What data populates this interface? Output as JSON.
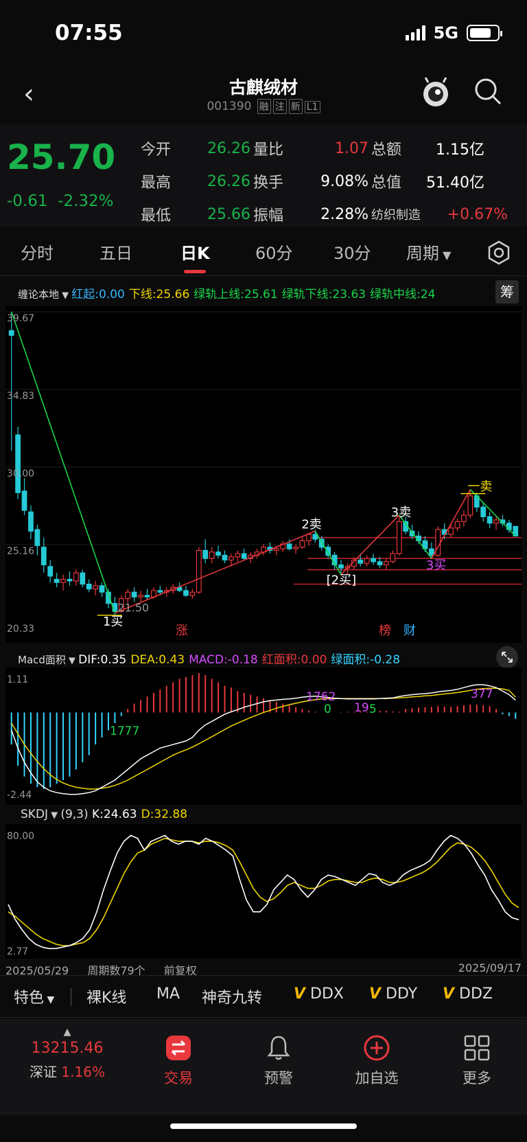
{
  "status": {
    "time": "07:55",
    "network": "5G"
  },
  "header": {
    "title": "古麒绒材",
    "code": "001390",
    "tags": [
      "融",
      "注",
      "新",
      "L1"
    ]
  },
  "quote": {
    "price": "25.70",
    "change": "-0.61",
    "change_pct": "-2.32%",
    "rows": [
      [
        {
          "k": "今开",
          "v": "26.26",
          "c": "green"
        },
        {
          "k": "量比",
          "v": "1.07",
          "c": "red"
        },
        {
          "k": "总额",
          "v": "1.15亿",
          "c": "white"
        }
      ],
      [
        {
          "k": "最高",
          "v": "26.26",
          "c": "green"
        },
        {
          "k": "换手",
          "v": "9.08%",
          "c": "white"
        },
        {
          "k": "总值",
          "v": "51.40亿",
          "c": "white"
        }
      ],
      [
        {
          "k": "最低",
          "v": "25.66",
          "c": "green"
        },
        {
          "k": "振幅",
          "v": "2.28%",
          "c": "white"
        },
        {
          "k": "纺织制造",
          "v": "+0.67%",
          "c": "red"
        }
      ]
    ]
  },
  "tabs": [
    "分时",
    "五日",
    "日K",
    "60分",
    "30分",
    "周期"
  ],
  "main_indicator": {
    "name": "缠论本地",
    "items": [
      {
        "t": "红起:0.00",
        "c": "#35b5ff"
      },
      {
        "t": "下线:25.66",
        "c": "#f2d600"
      },
      {
        "t": "绿轨上线:25.61",
        "c": "#19d64b"
      },
      {
        "t": "绿轨下线:23.63",
        "c": "#19d64b"
      },
      {
        "t": "绿轨中线:24",
        "c": "#19d64b"
      }
    ],
    "side_button": "筹"
  },
  "chart_data": [
    {
      "type": "candlestick",
      "y_ticks": [
        "39.67",
        "34.83",
        "30.00",
        "25.16",
        "20.33"
      ],
      "ylim": [
        20.33,
        39.67
      ],
      "annotations": [
        "1买",
        "21.50",
        "2卖",
        "[2买]",
        "3卖",
        "3买",
        "一卖",
        "涨",
        "榜",
        "财"
      ],
      "candles": [
        [
          38.5,
          39.67,
          31.0,
          38.2
        ],
        [
          32.0,
          32.5,
          28.0,
          28.4
        ],
        [
          28.5,
          29.3,
          27.0,
          27.3
        ],
        [
          27.2,
          27.6,
          25.5,
          26.0
        ],
        [
          26.1,
          26.4,
          24.5,
          25.1
        ],
        [
          25.0,
          25.6,
          23.4,
          23.9
        ],
        [
          23.8,
          24.2,
          22.8,
          23.2
        ],
        [
          23.0,
          23.4,
          22.5,
          22.8
        ],
        [
          22.8,
          23.3,
          22.3,
          23.0
        ],
        [
          23.0,
          23.5,
          22.6,
          22.9
        ],
        [
          22.9,
          23.6,
          22.6,
          23.4
        ],
        [
          23.4,
          23.6,
          22.5,
          22.7
        ],
        [
          22.7,
          23.0,
          22.2,
          22.4
        ],
        [
          22.4,
          22.9,
          22.0,
          22.6
        ],
        [
          22.6,
          22.8,
          21.9,
          22.2
        ],
        [
          22.2,
          22.4,
          21.2,
          21.5
        ],
        [
          21.5,
          21.9,
          20.7,
          21.0
        ],
        [
          21.0,
          22.0,
          20.9,
          21.8
        ],
        [
          21.8,
          22.4,
          21.5,
          22.2
        ],
        [
          22.2,
          22.5,
          21.6,
          21.9
        ],
        [
          21.9,
          22.3,
          21.6,
          22.0
        ],
        [
          22.0,
          22.4,
          21.7,
          21.9
        ],
        [
          21.9,
          22.5,
          21.8,
          22.3
        ],
        [
          22.3,
          22.6,
          22.0,
          22.2
        ],
        [
          22.2,
          22.5,
          21.9,
          22.3
        ],
        [
          22.3,
          22.7,
          22.1,
          22.5
        ],
        [
          22.5,
          22.8,
          22.2,
          22.3
        ],
        [
          22.3,
          22.6,
          21.9,
          22.0
        ],
        [
          22.0,
          22.4,
          21.8,
          22.2
        ],
        [
          22.2,
          25.0,
          22.1,
          24.8
        ],
        [
          24.8,
          25.5,
          24.0,
          24.3
        ],
        [
          24.3,
          25.0,
          24.0,
          24.7
        ],
        [
          24.7,
          25.1,
          24.3,
          24.5
        ],
        [
          24.5,
          24.8,
          24.0,
          24.2
        ],
        [
          24.2,
          24.6,
          23.8,
          24.4
        ],
        [
          24.4,
          24.8,
          24.1,
          24.6
        ],
        [
          24.6,
          24.9,
          24.2,
          24.3
        ],
        [
          24.3,
          24.7,
          24.0,
          24.5
        ],
        [
          24.5,
          24.9,
          24.3,
          24.7
        ],
        [
          24.7,
          25.2,
          24.5,
          25.0
        ],
        [
          25.0,
          25.3,
          24.6,
          24.8
        ],
        [
          24.8,
          25.1,
          24.5,
          24.9
        ],
        [
          24.9,
          25.4,
          24.7,
          25.2
        ],
        [
          25.2,
          25.5,
          24.8,
          24.9
        ],
        [
          24.9,
          25.2,
          24.6,
          25.0
        ],
        [
          25.0,
          25.6,
          24.9,
          25.4
        ],
        [
          25.4,
          25.9,
          25.1,
          25.8
        ],
        [
          25.8,
          26.1,
          25.3,
          25.5
        ],
        [
          25.5,
          25.7,
          24.8,
          25.0
        ],
        [
          25.0,
          25.2,
          24.3,
          24.5
        ],
        [
          24.5,
          24.7,
          23.6,
          23.9
        ],
        [
          23.9,
          24.2,
          23.4,
          23.7
        ],
        [
          23.7,
          24.0,
          23.3,
          23.8
        ],
        [
          23.8,
          24.4,
          23.6,
          24.2
        ],
        [
          24.2,
          24.6,
          23.8,
          24.0
        ],
        [
          24.0,
          24.5,
          23.8,
          24.3
        ],
        [
          24.3,
          24.6,
          23.9,
          24.1
        ],
        [
          24.1,
          24.4,
          23.7,
          23.9
        ],
        [
          23.9,
          24.3,
          23.6,
          24.1
        ],
        [
          24.1,
          24.8,
          24.0,
          24.6
        ],
        [
          24.6,
          27.0,
          24.5,
          26.6
        ],
        [
          26.6,
          26.9,
          25.8,
          26.0
        ],
        [
          26.0,
          26.4,
          25.5,
          25.7
        ],
        [
          25.7,
          26.0,
          25.2,
          25.4
        ],
        [
          25.4,
          25.7,
          24.7,
          24.9
        ],
        [
          24.9,
          25.3,
          24.3,
          24.5
        ],
        [
          24.5,
          26.3,
          24.4,
          26.1
        ],
        [
          26.1,
          26.5,
          25.5,
          25.8
        ],
        [
          25.8,
          26.4,
          25.6,
          26.2
        ],
        [
          26.2,
          26.8,
          26.0,
          26.6
        ],
        [
          26.6,
          27.3,
          26.3,
          27.0
        ],
        [
          27.0,
          28.6,
          26.8,
          28.2
        ],
        [
          28.2,
          28.4,
          27.2,
          27.5
        ],
        [
          27.5,
          27.8,
          26.6,
          26.9
        ],
        [
          26.9,
          27.2,
          26.2,
          26.5
        ],
        [
          26.5,
          26.9,
          26.1,
          26.7
        ],
        [
          26.7,
          27.0,
          26.3,
          26.5
        ],
        [
          26.5,
          26.7,
          25.9,
          26.1
        ],
        [
          26.3,
          26.3,
          25.66,
          25.7
        ]
      ]
    },
    {
      "type": "bar",
      "name": "Macd面积",
      "legend": [
        {
          "t": "DIF:0.35",
          "c": "#ffffff"
        },
        {
          "t": "DEA:0.43",
          "c": "#f2d600"
        },
        {
          "t": "MACD:-0.18",
          "c": "#d64bff"
        },
        {
          "t": "红面积:0.00",
          "c": "#e8383d"
        },
        {
          "t": "绿面积:-0.28",
          "c": "#35d5ff"
        }
      ],
      "y_ticks": [
        "1.11",
        "-2.44"
      ],
      "ylim": [
        -2.44,
        1.11
      ],
      "area_labels": [
        "1777",
        "1762",
        "0",
        "19",
        "5",
        "377"
      ],
      "values": [
        -0.9,
        -1.5,
        -1.8,
        -2.0,
        -2.1,
        -2.15,
        -2.1,
        -2.0,
        -1.9,
        -1.8,
        -1.6,
        -1.4,
        -1.2,
        -0.9,
        -0.7,
        -0.5,
        -0.3,
        -0.1,
        0.1,
        0.25,
        0.35,
        0.45,
        0.55,
        0.65,
        0.75,
        0.85,
        0.95,
        1.0,
        1.05,
        1.11,
        1.05,
        0.95,
        0.85,
        0.75,
        0.7,
        0.6,
        0.55,
        0.5,
        0.45,
        0.4,
        0.35,
        0.3,
        0.25,
        0.2,
        0.15,
        0.1,
        0.05,
        0.02,
        0.0,
        -0.01,
        0.0,
        0.01,
        0.02,
        0.02,
        0.03,
        0.02,
        0.03,
        0.05,
        0.05,
        0.03,
        0.02,
        0.1,
        0.12,
        0.14,
        0.15,
        0.16,
        0.18,
        0.17,
        0.16,
        0.18,
        0.2,
        0.22,
        0.22,
        0.2,
        0.18,
        0.1,
        -0.05,
        -0.1,
        -0.18
      ],
      "dif": [
        -0.5,
        -1.0,
        -1.4,
        -1.7,
        -1.95,
        -2.1,
        -2.2,
        -2.25,
        -2.28,
        -2.3,
        -2.3,
        -2.28,
        -2.25,
        -2.2,
        -2.1,
        -2.0,
        -1.9,
        -1.75,
        -1.6,
        -1.45,
        -1.3,
        -1.2,
        -1.1,
        -1.0,
        -0.95,
        -0.9,
        -0.85,
        -0.8,
        -0.7,
        -0.5,
        -0.35,
        -0.25,
        -0.15,
        -0.05,
        0.02,
        0.08,
        0.15,
        0.2,
        0.25,
        0.3,
        0.33,
        0.35,
        0.37,
        0.38,
        0.4,
        0.43,
        0.45,
        0.46,
        0.44,
        0.42,
        0.4,
        0.39,
        0.38,
        0.38,
        0.38,
        0.38,
        0.38,
        0.39,
        0.4,
        0.41,
        0.45,
        0.48,
        0.5,
        0.52,
        0.53,
        0.55,
        0.58,
        0.6,
        0.62,
        0.65,
        0.7,
        0.75,
        0.78,
        0.78,
        0.75,
        0.7,
        0.6,
        0.5,
        0.35
      ],
      "dea": [
        -0.3,
        -0.6,
        -0.9,
        -1.15,
        -1.38,
        -1.58,
        -1.75,
        -1.88,
        -1.98,
        -2.05,
        -2.1,
        -2.13,
        -2.15,
        -2.15,
        -2.13,
        -2.1,
        -2.05,
        -1.98,
        -1.9,
        -1.8,
        -1.7,
        -1.6,
        -1.5,
        -1.4,
        -1.3,
        -1.2,
        -1.12,
        -1.05,
        -0.97,
        -0.88,
        -0.78,
        -0.68,
        -0.58,
        -0.48,
        -0.38,
        -0.3,
        -0.22,
        -0.14,
        -0.07,
        0.0,
        0.06,
        0.12,
        0.17,
        0.22,
        0.26,
        0.3,
        0.33,
        0.36,
        0.38,
        0.39,
        0.39,
        0.39,
        0.39,
        0.39,
        0.39,
        0.39,
        0.39,
        0.39,
        0.39,
        0.4,
        0.41,
        0.42,
        0.44,
        0.45,
        0.47,
        0.48,
        0.5,
        0.52,
        0.54,
        0.56,
        0.59,
        0.62,
        0.65,
        0.67,
        0.68,
        0.68,
        0.66,
        0.62,
        0.43
      ]
    },
    {
      "type": "line",
      "name": "SKDJ",
      "legend_params": "(9,3)",
      "legend": [
        {
          "t": "K:24.63",
          "c": "#ffffff"
        },
        {
          "t": "D:32.88",
          "c": "#f2d600"
        }
      ],
      "y_ticks": [
        "80.00",
        "2.77"
      ],
      "ylim": [
        2.77,
        80.0
      ],
      "k": [
        35,
        25,
        18,
        12,
        8,
        6,
        5,
        5,
        6,
        7,
        9,
        12,
        18,
        30,
        45,
        58,
        70,
        78,
        82,
        80,
        72,
        78,
        80,
        82,
        78,
        76,
        78,
        78,
        76,
        80,
        78,
        75,
        72,
        68,
        52,
        38,
        30,
        30,
        35,
        45,
        50,
        55,
        52,
        45,
        40,
        45,
        52,
        55,
        54,
        52,
        50,
        48,
        52,
        56,
        55,
        50,
        48,
        50,
        55,
        58,
        60,
        62,
        65,
        72,
        78,
        82,
        80,
        76,
        70,
        62,
        55,
        45,
        38,
        30,
        26,
        24.63
      ],
      "d": [
        30,
        27,
        23,
        19,
        15,
        12,
        10,
        8,
        7,
        7,
        8,
        9,
        12,
        18,
        26,
        36,
        46,
        56,
        64,
        70,
        72,
        76,
        78,
        80,
        79,
        78,
        78,
        78,
        77,
        78,
        78,
        77,
        75,
        72,
        64,
        55,
        46,
        40,
        37,
        39,
        43,
        48,
        50,
        48,
        46,
        46,
        48,
        51,
        52,
        52,
        51,
        50,
        50,
        52,
        53,
        52,
        50,
        50,
        51,
        53,
        55,
        57,
        60,
        64,
        69,
        74,
        77,
        76,
        74,
        70,
        65,
        58,
        50,
        42,
        36,
        32.88
      ]
    }
  ],
  "chart_footer": {
    "start_date": "2025/05/29",
    "period_count": "周期数79个",
    "adjust": "前复权",
    "end_date": "2025/09/17"
  },
  "toolbar": [
    "特色",
    "裸K线",
    "MA",
    "神奇九转",
    "DDX",
    "DDY",
    "DDZ"
  ],
  "footer": {
    "index_value": "13215.46",
    "index_name": "深证",
    "index_pct": "1.16%",
    "items": [
      "交易",
      "预警",
      "加自选",
      "更多"
    ]
  },
  "colors": {
    "up": "#e8383d",
    "down": "#26c9d6",
    "green_line": "#19d64b",
    "yellow": "#f2d600"
  }
}
